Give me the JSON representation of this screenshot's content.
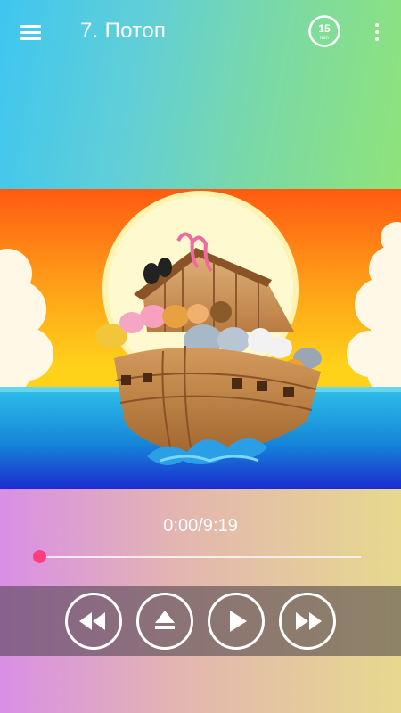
{
  "header": {
    "title": "7. Потоп",
    "menu_icon": "hamburger-menu-icon",
    "timer": {
      "icon": "sleep-timer-icon",
      "value": "15",
      "unit": "min"
    },
    "more_icon": "more-vertical-icon"
  },
  "artwork": {
    "subject": "noah-ark-illustration"
  },
  "player": {
    "time_display": "0:00/9:19",
    "progress": 0.0,
    "controls": {
      "rewind_icon": "rewind-icon",
      "eject_icon": "eject-icon",
      "play_icon": "play-icon",
      "forward_icon": "fast-forward-icon"
    }
  },
  "colors": {
    "accent": "#ff3d7f",
    "control_bar": "#463c46"
  }
}
